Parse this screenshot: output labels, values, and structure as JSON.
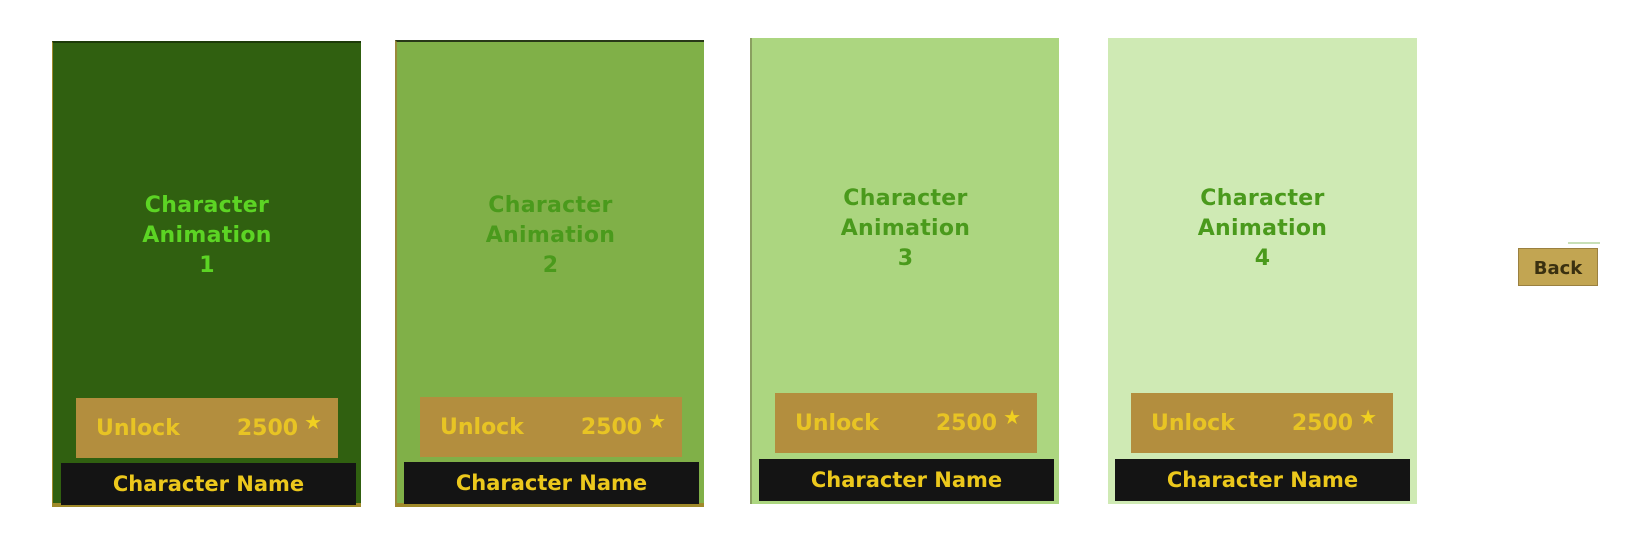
{
  "cards": [
    {
      "animation_label": "Character\nAnimation\n1",
      "unlock_label": "Unlock",
      "price": "2500",
      "price_icon": "star-icon",
      "name": "Character Name"
    },
    {
      "animation_label": "Character\nAnimation\n2",
      "unlock_label": "Unlock",
      "price": "2500",
      "price_icon": "star-icon",
      "name": "Character Name"
    },
    {
      "animation_label": "Character\nAnimation\n3",
      "unlock_label": "Unlock",
      "price": "2500",
      "price_icon": "star-icon",
      "name": "Character Name"
    },
    {
      "animation_label": "Character\nAnimation\n4",
      "unlock_label": "Unlock",
      "price": "2500",
      "price_icon": "star-icon",
      "name": "Character Name"
    }
  ],
  "back_button": {
    "label": "Back"
  },
  "colors": {
    "card_1_bg": "#306010",
    "card_2_bg": "#80b048",
    "card_3_bg": "#acd680",
    "card_4_bg": "#cfeab4",
    "unlock_button_bg": "#b38e3e",
    "unlock_text": "#e8c424",
    "name_bar_bg": "#141414",
    "name_text": "#ecc81c",
    "back_button_bg": "#c2a552"
  }
}
